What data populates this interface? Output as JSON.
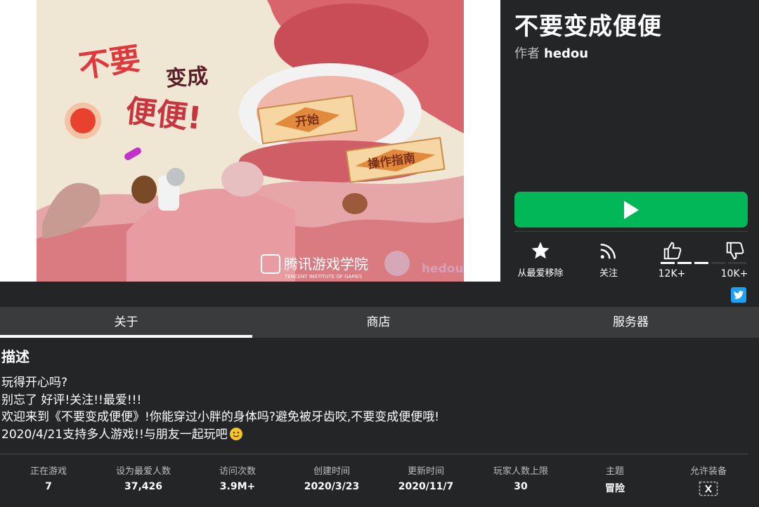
{
  "game": {
    "title": "不要变成便便",
    "creator_prefix": "作者",
    "creator_name": "hedou"
  },
  "thumbnail": {
    "title_lines": [
      "不要",
      "变成",
      "便便!"
    ],
    "start_label": "开始",
    "guide_label": "操作指南",
    "brand_text": "腾讯游戏学院",
    "brand_subtext": "TENCENT INSTITUTE OF GAMES",
    "brand_author": "hedou"
  },
  "actions": {
    "favorite_label": "从最爱移除",
    "follow_label": "关注",
    "upvotes": "12K+",
    "downvotes": "10K+"
  },
  "tabs": [
    {
      "label": "关于",
      "active": true
    },
    {
      "label": "商店",
      "active": false
    },
    {
      "label": "服务器",
      "active": false
    }
  ],
  "description": {
    "heading": "描述",
    "lines": [
      "玩得开心吗?",
      "别忘了 好评!关注!!最爱!!!",
      "欢迎来到《不要变成便便》!你能穿过小胖的身体吗?避免被牙齿咬,不要变成便便哦!",
      "2020/4/21支持多人游戏!!与朋友一起玩吧"
    ]
  },
  "stats": [
    {
      "label": "正在游戏",
      "value": "7"
    },
    {
      "label": "设为最爱人数",
      "value": "37,426"
    },
    {
      "label": "访问次数",
      "value": "3.9M+"
    },
    {
      "label": "创建时间",
      "value": "2020/3/23"
    },
    {
      "label": "更新时间",
      "value": "2020/11/7"
    },
    {
      "label": "玩家人数上限",
      "value": "30"
    },
    {
      "label": "主题",
      "value": "冒险"
    },
    {
      "label": "允许装备",
      "value": ""
    }
  ],
  "colors": {
    "play": "#02b757",
    "background": "#232527",
    "tab_bar": "#393b3d",
    "twitter": "#1da1f2"
  }
}
